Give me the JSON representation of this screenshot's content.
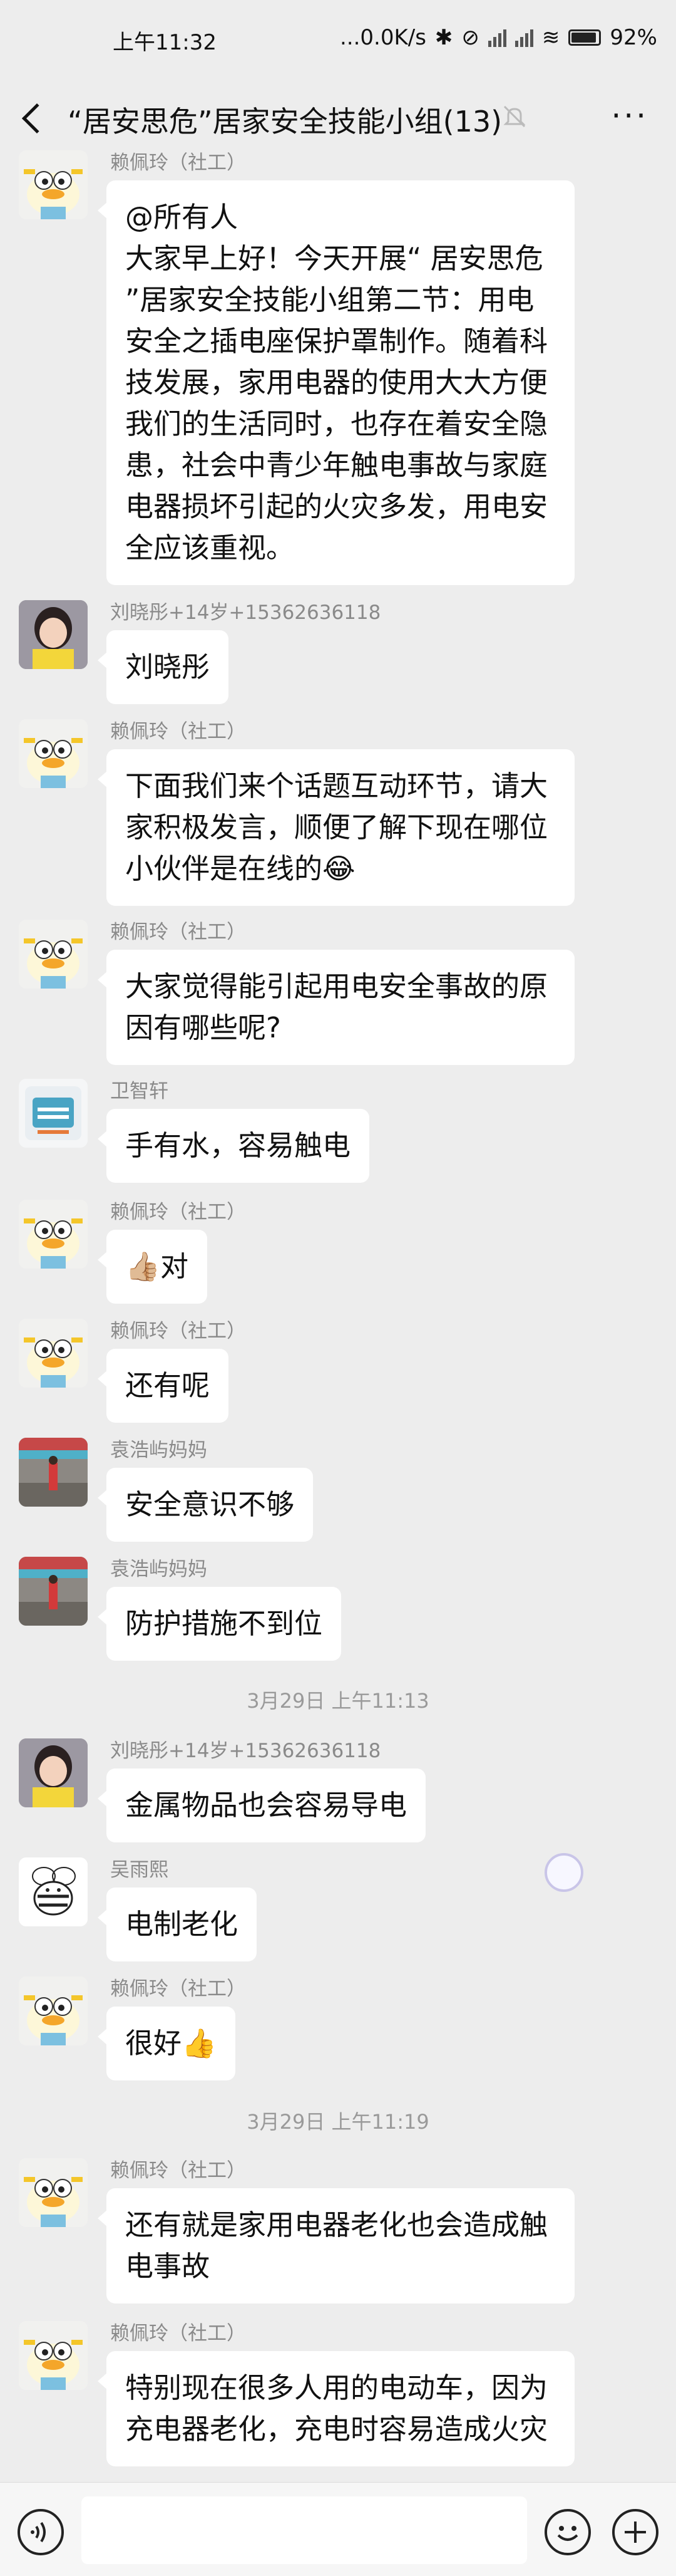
{
  "status_bar": {
    "time": "上午11:32",
    "network_speed": "...0.0K/s",
    "battery": "92%",
    "battery_level": 0.92
  },
  "header": {
    "title": "“居安思危”居家安全技能小组(13)"
  },
  "messages": [
    {
      "sender": "赖佩玲（社工）",
      "avatar": "duck-avatar",
      "text": "@所有人\n大家早上好！今天开展“ 居安思危 ”居家安全技能小组第二节：用电安全之插电座保护罩制作。随着科技发展，家用电器的使用大大方便我们的生活同时，也存在着安全隐患，社会中青少年触电事故与家庭电器损坏引起的火灾多发，用电安全应该重视。"
    },
    {
      "sender": "刘晓彤+14岁+15362636118",
      "avatar": "girl-avatar",
      "text": "刘晓彤"
    },
    {
      "sender": "赖佩玲（社工）",
      "avatar": "duck-avatar",
      "text": "下面我们来个话题互动环节，请大家积极发言，顺便了解下现在哪位小伙伴是在线的😂"
    },
    {
      "sender": "赖佩玲（社工）",
      "avatar": "duck-avatar",
      "text": "大家觉得能引起用电安全事故的原因有哪些呢?"
    },
    {
      "sender": "卫智轩",
      "avatar": "book-avatar",
      "text": "手有水，容易触电"
    },
    {
      "sender": "赖佩玲（社工）",
      "avatar": "duck-avatar",
      "text": "👍🏼对"
    },
    {
      "sender": "赖佩玲（社工）",
      "avatar": "duck-avatar",
      "text": "还有呢"
    },
    {
      "sender": "袁浩屿妈妈",
      "avatar": "street-avatar",
      "text": "安全意识不够"
    },
    {
      "sender": "袁浩屿妈妈",
      "avatar": "street-avatar",
      "text": "防护措施不到位"
    },
    {
      "sender": "刘晓彤+14岁+15362636118",
      "avatar": "girl-avatar",
      "text": "金属物品也会容易导电"
    },
    {
      "sender": "吴雨熙",
      "avatar": "bee-avatar",
      "text": "电制老化"
    },
    {
      "sender": "赖佩玲（社工）",
      "avatar": "duck-avatar",
      "text": "很好👍"
    },
    {
      "sender": "赖佩玲（社工）",
      "avatar": "duck-avatar",
      "text": "还有就是家用电器老化也会造成触电事故"
    },
    {
      "sender": "赖佩玲（社工）",
      "avatar": "duck-avatar",
      "text": "特别现在很多人用的电动车，因为充电器老化，充电时容易造成火灾"
    }
  ],
  "timestamps": [
    "3月29日 上午11:13",
    "3月29日 上午11:19"
  ],
  "input": {
    "placeholder": ""
  }
}
